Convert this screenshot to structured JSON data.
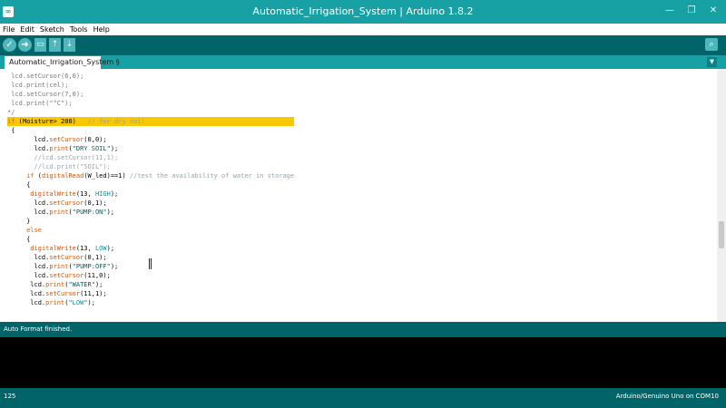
{
  "window": {
    "title": "Automatic_Irrigation_System | Arduino 1.8.2",
    "logo_text": "∞",
    "controls": {
      "minimize": "—",
      "maximize": "❐",
      "close": "✕"
    }
  },
  "menu": {
    "items": [
      "File",
      "Edit",
      "Sketch",
      "Tools",
      "Help"
    ]
  },
  "toolbar": {
    "verify_icon": "verify-icon",
    "upload_icon": "upload-icon",
    "new_icon": "new-sketch-icon",
    "open_icon": "open-icon",
    "save_icon": "save-icon",
    "serial_icon": "serial-monitor-icon",
    "verify_glyph": "✓",
    "upload_glyph": "➜",
    "new_glyph": "▭",
    "open_glyph": "⇡",
    "save_glyph": "⇣",
    "serial_glyph": "⌕"
  },
  "tabs": {
    "active": "Automatic_Irrigation_System §",
    "menu_glyph": "▼"
  },
  "editor": {
    "lines": [
      " lcd.setCursor(6,0);",
      " lcd.print(cel);",
      " lcd.setCursor(7,0);",
      " lcd.print(\"°C\");",
      "*/",
      "if (Moisture> 200)   // for dry soil",
      " {",
      "       lcd.setCursor(0,0);",
      "       lcd.print(\"DRY SOIL\");",
      "       //lcd.setCursor(11,1);",
      "       //lcd.print(\"SOIL\");",
      "     if (digitalRead(W_led)==1) //test the availability of water in storage",
      "     {",
      "      digitalWrite(13, HIGH);",
      "       lcd.setCursor(0,1);",
      "       lcd.print(\"PUMP:ON\");",
      "     }",
      "     else",
      "     {",
      "      digitalWrite(13, LOW);",
      "       lcd.setCursor(0,1);",
      "       lcd.print(\"PUMP:OFF\");",
      "       lcd.setCursor(11,0);",
      "      lcd.print(\"WATER\");",
      "      lcd.setCursor(11,1);",
      "      lcd.print(\"LOW\");"
    ],
    "highlight_line": 5,
    "faded_lines": [
      0,
      1,
      2,
      3,
      4
    ]
  },
  "status": {
    "message": "Auto Format finished."
  },
  "footer": {
    "line_number": "125",
    "board": "Arduino/Genuino Uno on COM10"
  },
  "colors": {
    "accent": "#17a1a5",
    "toolbar": "#006468",
    "highlight": "#f9c800",
    "keyword": "#cc6600",
    "function": "#d35400",
    "comment": "#95a5a6",
    "constant": "#00979c"
  }
}
